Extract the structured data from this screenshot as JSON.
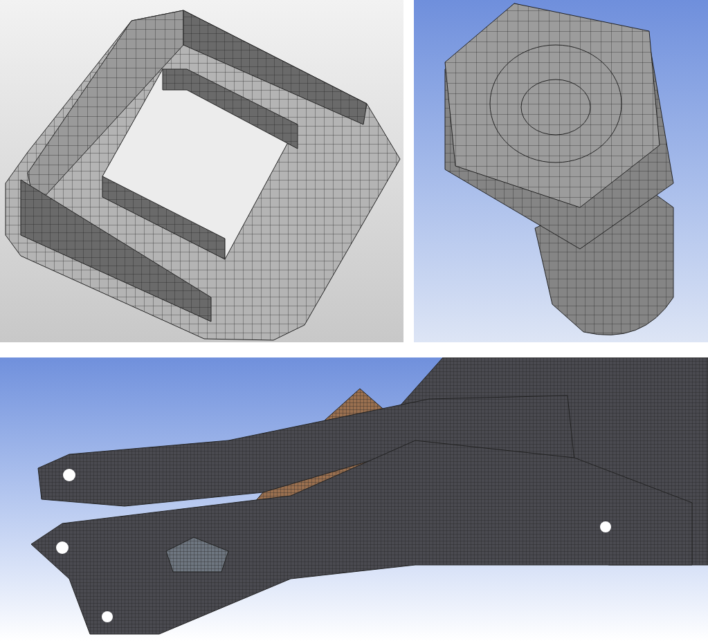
{
  "panels": [
    {
      "kind": "frame"
    },
    {
      "kind": "bolt"
    },
    {
      "kind": "assembly"
    }
  ]
}
